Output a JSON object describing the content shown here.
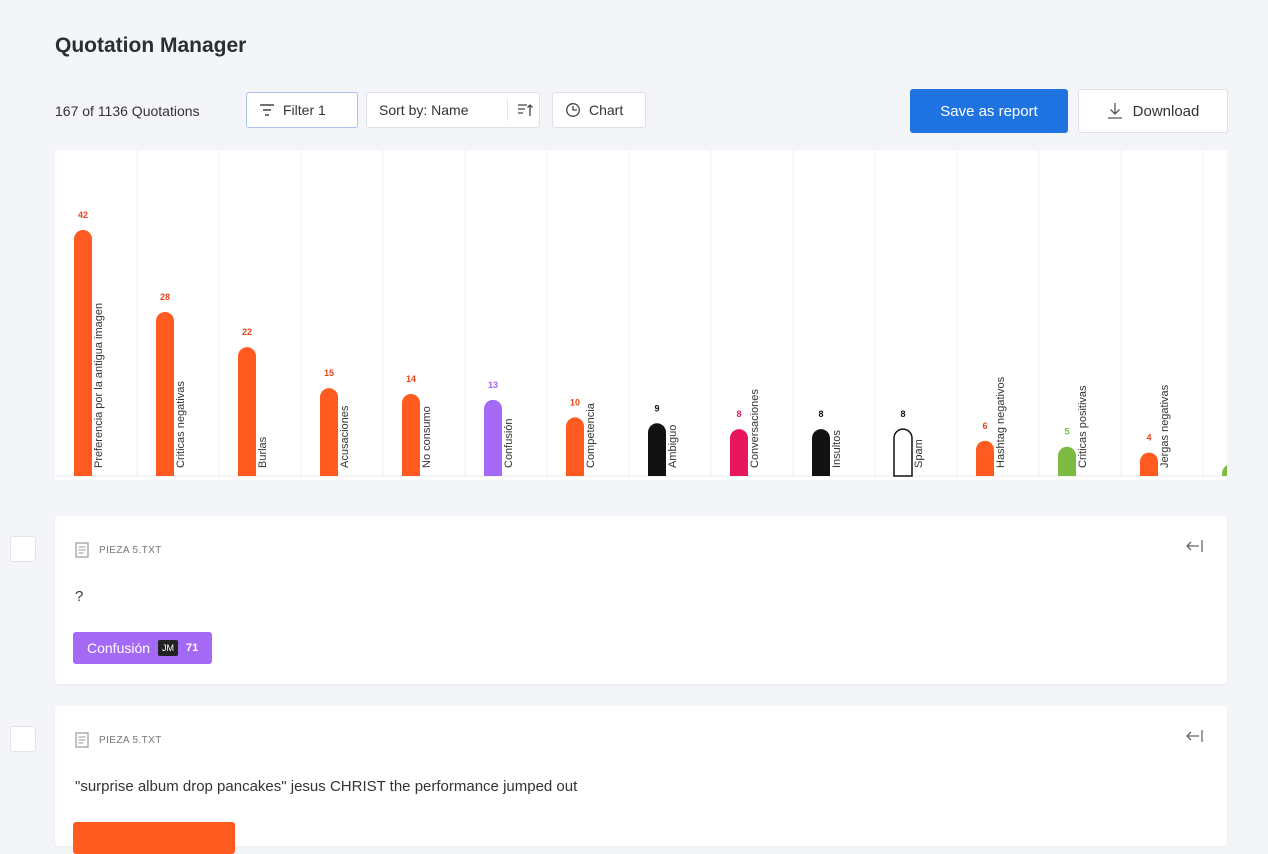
{
  "header": {
    "title": "Quotation Manager",
    "count_label": "167 of 1136 Quotations",
    "filter_label": "Filter 1",
    "sort_label": "Sort by: Name",
    "chart_label": "Chart",
    "save_label": "Save as report",
    "download_label": "Download"
  },
  "chart_data": {
    "type": "bar",
    "categories": [
      "Preferencia por la antigua imagen",
      "Criticas negativas",
      "Burlas",
      "Acusaciones",
      "No consumo",
      "Confusión",
      "Competencia",
      "Ambiguo",
      "Conversaciones",
      "Insultos",
      "Spam",
      "Hashtag negativos",
      "Criticas positivas",
      "Jergas negativas",
      ""
    ],
    "values": [
      42,
      28,
      22,
      15,
      14,
      13,
      10,
      9,
      8,
      8,
      8,
      6,
      5,
      4,
      2
    ],
    "colors": [
      "#ff5a1f",
      "#ff5a1f",
      "#ff5a1f",
      "#ff5a1f",
      "#ff5a1f",
      "#a469f5",
      "#ff5a1f",
      "#111111",
      "#e8175d",
      "#111111",
      "#ffffff",
      "#ff5a1f",
      "#7dbb42",
      "#ff5a1f",
      "#7dbb42"
    ],
    "label_colors": [
      "#e8441a",
      "#e8441a",
      "#e8441a",
      "#e8441a",
      "#e8441a",
      "#a469f5",
      "#e8441a",
      "#111111",
      "#e8175d",
      "#111111",
      "#111111",
      "#e8441a",
      "#7dbb42",
      "#e8441a",
      "#7dbb42"
    ],
    "outlined": [
      false,
      false,
      false,
      false,
      false,
      false,
      false,
      false,
      false,
      false,
      true,
      false,
      false,
      false,
      false
    ],
    "ylim": [
      0,
      42
    ]
  },
  "quotes": [
    {
      "file": "PIEZA 5.TXT",
      "text": "?",
      "tag_label": "Confusión",
      "tag_user": "JM",
      "tag_num": "71",
      "tag_color": "#a469f5"
    },
    {
      "file": "PIEZA 5.TXT",
      "text": "\"surprise album drop pancakes\" jesus CHRIST the performance jumped out",
      "tag_color": "#ff5a1f"
    }
  ]
}
